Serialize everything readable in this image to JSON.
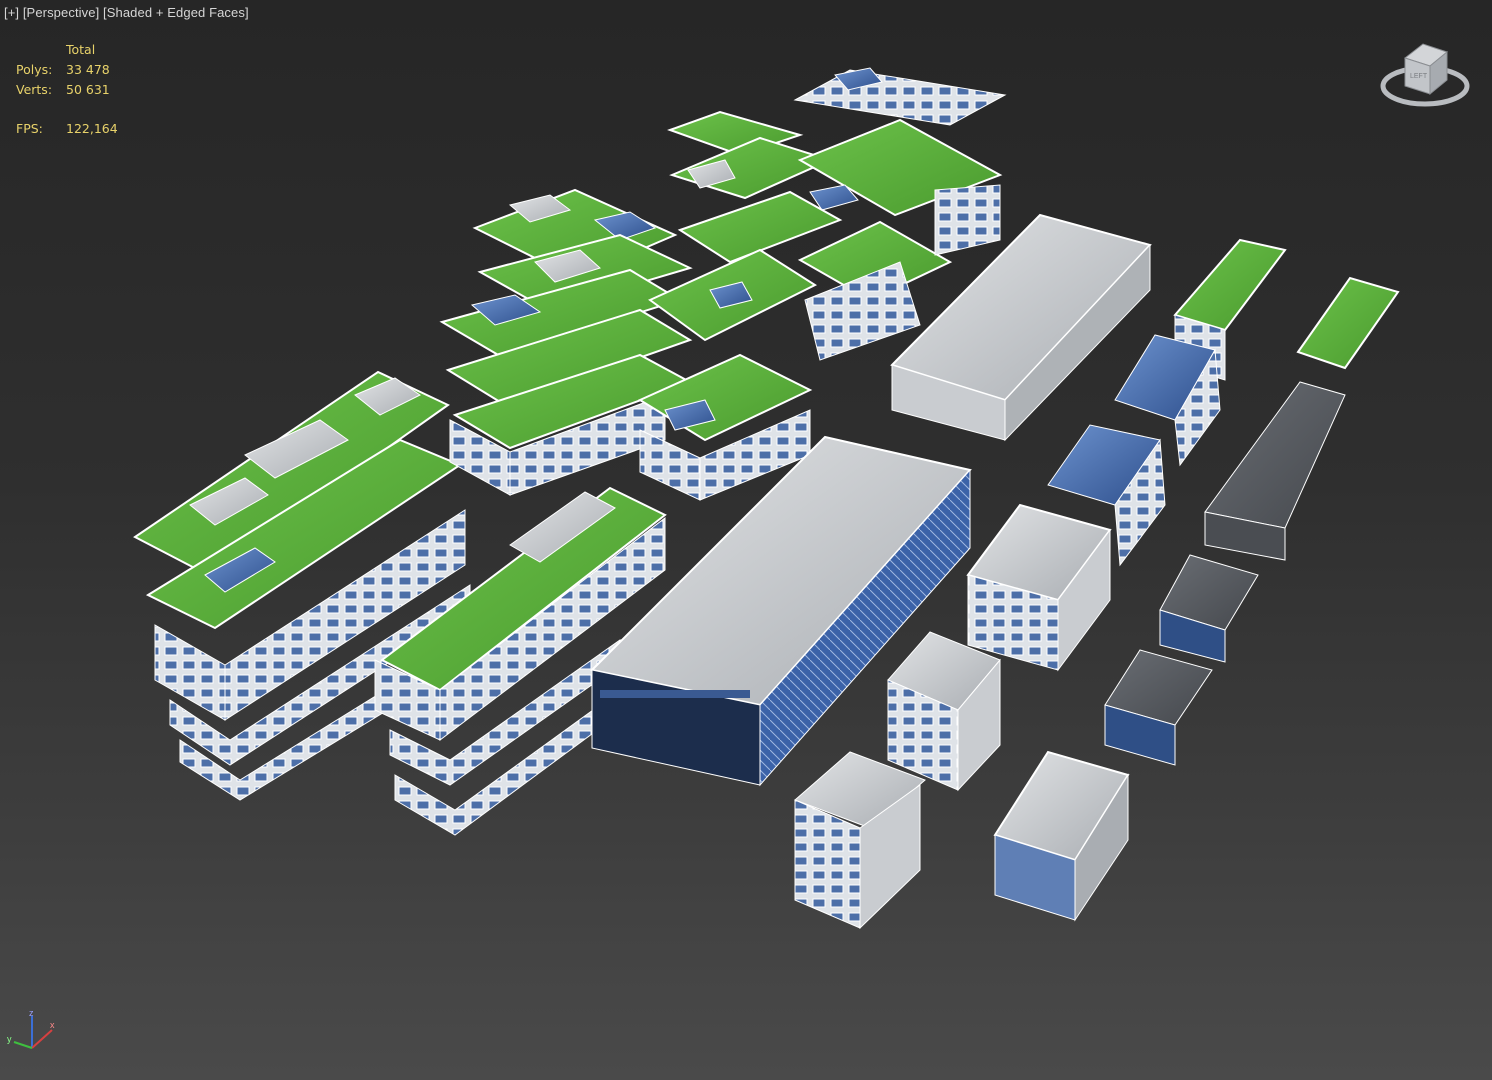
{
  "viewport": {
    "label_plus": "[+]",
    "label_view": "[Perspective]",
    "label_shading": "[Shaded + Edged Faces]"
  },
  "stats": {
    "header": "Total",
    "polys_label": "Polys:",
    "polys_value": "33 478",
    "verts_label": "Verts:",
    "verts_value": "50 631",
    "fps_label": "FPS:",
    "fps_value": "122,164"
  },
  "viewcube": {
    "icon": "viewcube-icon",
    "face_label": "LEFT"
  },
  "axis_tripod": {
    "x": "x",
    "y": "y",
    "z": "z"
  },
  "colors": {
    "background_top": "#262626",
    "background_bottom": "#4a4a4a",
    "overlay_text": "#d6d6d6",
    "stats_text": "#e8d26a",
    "roof_green": "#5aad3a",
    "glass_blue": "#4a78c0",
    "concrete": "#9a9ea3",
    "edge": "#ffffff"
  }
}
